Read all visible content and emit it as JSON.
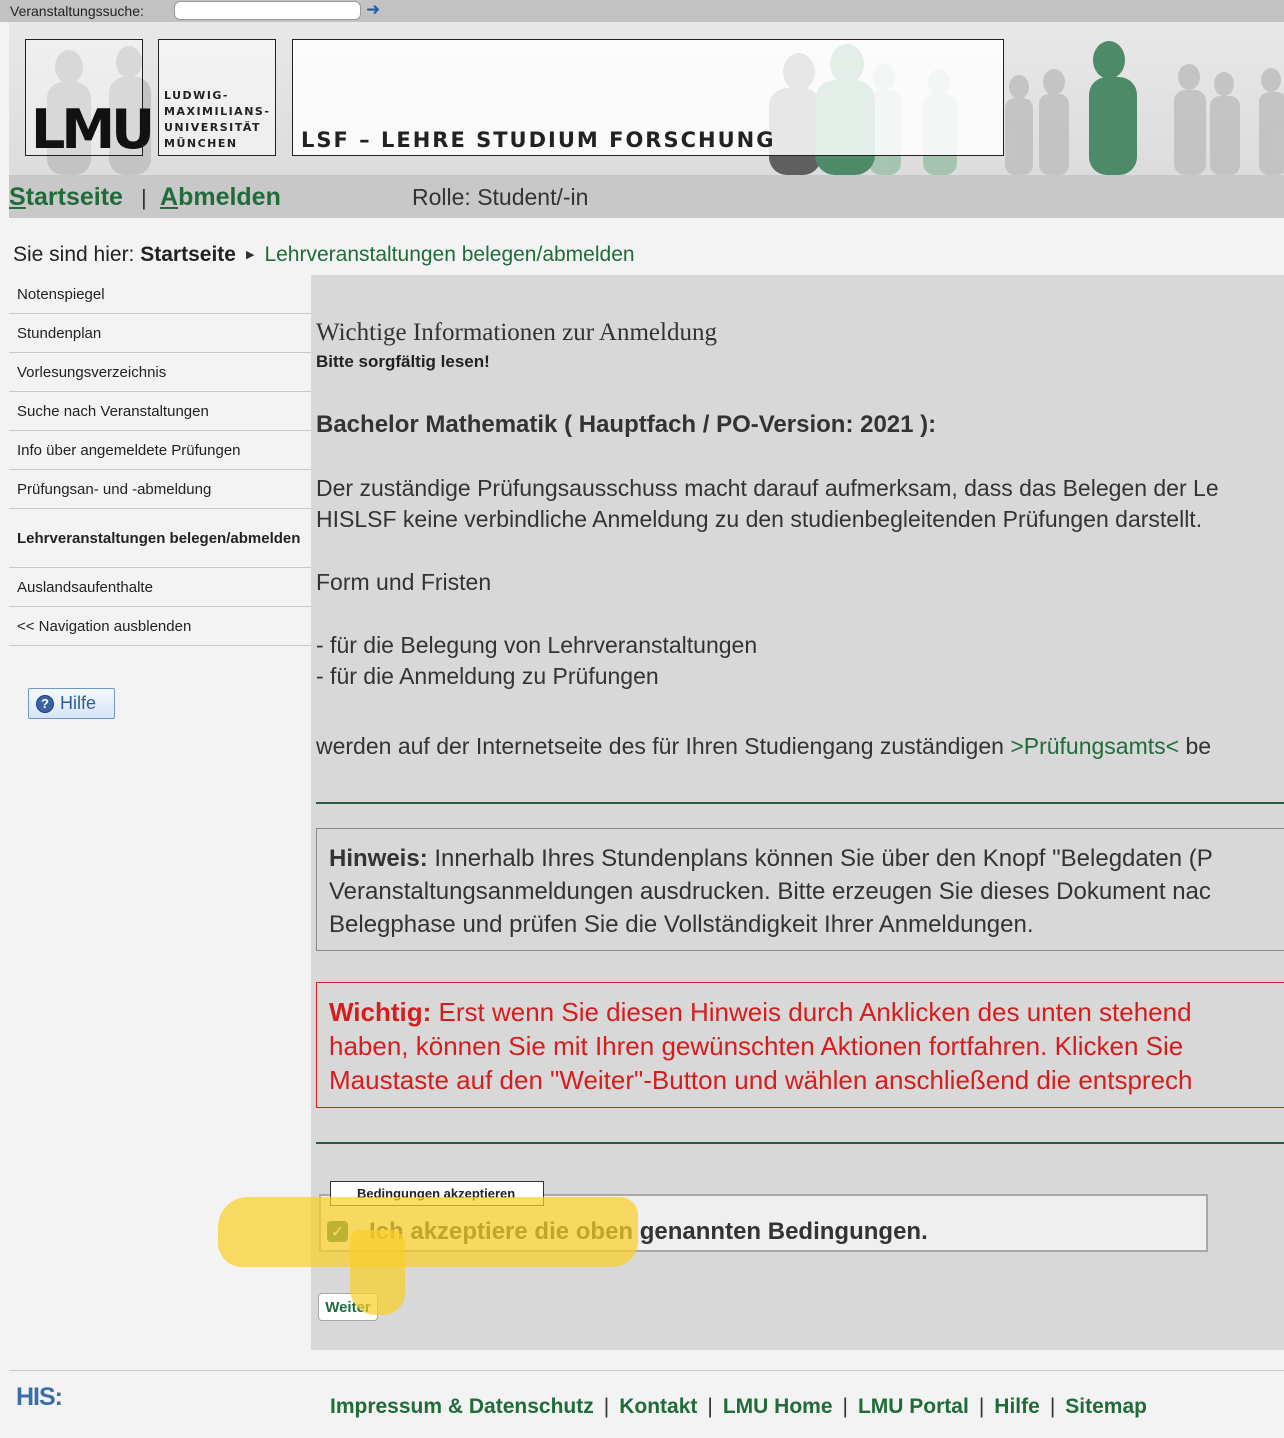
{
  "topbar": {
    "search_label": "Veranstaltungssuche:",
    "search_value": "",
    "go_icon": "arrow-right-icon"
  },
  "header": {
    "logo_text": "LMU",
    "university_lines": [
      "LUDWIG-",
      "MAXIMILIANS-",
      "UNIVERSITÄT",
      "MÜNCHEN"
    ],
    "system_title": "LSF – LEHRE STUDIUM FORSCHUNG"
  },
  "nav": {
    "home": "Startseite",
    "home_key": "S",
    "home_rest": "tartseite",
    "logout_key": "A",
    "logout_rest": "bmelden",
    "separator": "|",
    "role": "Rolle: Student/-in"
  },
  "breadcrumb": {
    "prefix": "Sie sind hier:",
    "home": "Startseite",
    "current": "Lehrveranstaltungen belegen/abmelden"
  },
  "sidebar": {
    "items": [
      {
        "label": "Notenspiegel"
      },
      {
        "label": "Stundenplan"
      },
      {
        "label": "Vorlesungsverzeichnis"
      },
      {
        "label": "Suche nach Veranstaltungen"
      },
      {
        "label": "Info über angemeldete Prüfungen"
      },
      {
        "label": "Prüfungsan- und -abmeldung"
      },
      {
        "label": "Lehrveranstaltungen belegen/abmelden"
      },
      {
        "label": "Auslandsaufenthalte"
      },
      {
        "label": "<< Navigation ausblenden"
      }
    ],
    "help_label": "Hilfe"
  },
  "main": {
    "title": "Wichtige Informationen zur Anmeldung",
    "subtitle": "Bitte sorgfältig lesen!",
    "program": "Bachelor Mathematik ( Hauptfach / PO-Version: 2021 ):",
    "para1_line1": "Der zuständige Prüfungsausschuss macht darauf aufmerksam, dass das Belegen der Le",
    "para1_line2": "HISLSF keine verbindliche Anmeldung zu den studienbegleitenden Prüfungen darstellt.",
    "form_fristen": "Form und Fristen",
    "list1": "- für die Belegung von Lehrveranstaltungen",
    "list2": "- für die Anmeldung zu Prüfungen",
    "website_pre": "werden auf der Internetseite des für Ihren Studiengang zuständigen ",
    "website_link": ">Prüfungsamts<",
    "website_post": " be",
    "note_label": "Hinweis:",
    "note_line1": " Innerhalb Ihres Stundenplans können Sie über den Knopf \"Belegdaten (P",
    "note_line2": "Veranstaltungsanmeldungen ausdrucken. Bitte erzeugen Sie dieses Dokument nac",
    "note_line3": "Belegphase und prüfen Sie die Vollständigkeit Ihrer Anmeldungen.",
    "warn_label": "Wichtig:",
    "warn_line1": " Erst wenn Sie diesen Hinweis durch Anklicken des unten stehend",
    "warn_line2": "haben, können Sie mit Ihren gewünschten Aktionen fortfahren. Klicken Sie",
    "warn_line3": "Maustaste auf den \"Weiter\"-Button und wählen anschließend die entsprech",
    "fieldset_legend": "Bedingungen akzeptieren",
    "accept_label": "Ich akzeptiere die oben genannten Bedingungen.",
    "accept_checked": true,
    "continue_label": "Weiter"
  },
  "footer": {
    "brand": "HIS:",
    "links": [
      "Impressum & Datenschutz",
      "Kontakt",
      "LMU Home",
      "LMU Portal",
      "Hilfe",
      "Sitemap"
    ]
  },
  "colors": {
    "accent_green": "#1f6b3a",
    "warning_red": "#d61d1d",
    "highlight_yellow": "#face28"
  }
}
